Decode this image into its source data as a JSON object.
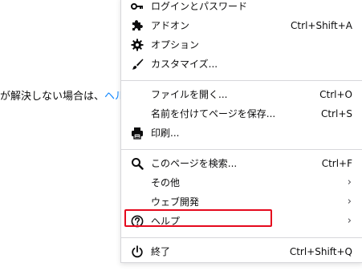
{
  "background": {
    "text": "が解決しない場合は、",
    "link": "ヘルプ"
  },
  "menu": {
    "items": [
      {
        "id": "logins",
        "label": "ログインとパスワード",
        "shortcut": "",
        "icon": "key-icon"
      },
      {
        "id": "addons",
        "label": "アドオン",
        "shortcut": "Ctrl+Shift+A",
        "icon": "puzzle-icon"
      },
      {
        "id": "options",
        "label": "オプション",
        "shortcut": "",
        "icon": "gear-icon"
      },
      {
        "id": "customize",
        "label": "カスタマイズ...",
        "shortcut": "",
        "icon": "paintbrush-icon"
      },
      {
        "id": "open-file",
        "label": "ファイルを開く...",
        "shortcut": "Ctrl+O",
        "icon": ""
      },
      {
        "id": "save-page",
        "label": "名前を付けてページを保存...",
        "shortcut": "Ctrl+S",
        "icon": ""
      },
      {
        "id": "print",
        "label": "印刷...",
        "shortcut": "",
        "icon": "printer-icon"
      },
      {
        "id": "find",
        "label": "このページを検索...",
        "shortcut": "Ctrl+F",
        "icon": "search-icon"
      },
      {
        "id": "more",
        "label": "その他",
        "shortcut": "",
        "icon": "",
        "submenu": "›"
      },
      {
        "id": "web-dev",
        "label": "ウェブ開発",
        "shortcut": "",
        "icon": "",
        "submenu": "›"
      },
      {
        "id": "help",
        "label": "ヘルプ",
        "shortcut": "",
        "icon": "question-circle-icon",
        "submenu": "›"
      },
      {
        "id": "quit",
        "label": "終了",
        "shortcut": "Ctrl+Shift+Q",
        "icon": "power-icon"
      }
    ]
  },
  "colors": {
    "highlight": "#e5091d",
    "link": "#0a84ff",
    "separator": "#d7d7db"
  }
}
